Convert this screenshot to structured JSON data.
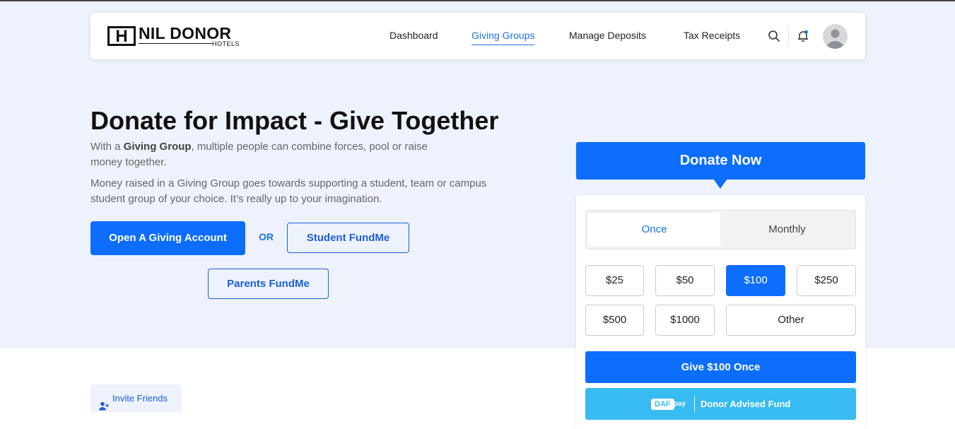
{
  "brand": {
    "logo_mark": "H",
    "name": "NIL DONOR",
    "sub": "HOTELS"
  },
  "nav": {
    "links": [
      {
        "label": "Dashboard",
        "active": false
      },
      {
        "label": "Giving Groups",
        "active": true
      },
      {
        "label": "Manage Deposits",
        "active": false
      },
      {
        "label": "Tax Receipts",
        "active": false
      }
    ],
    "icons": [
      "search-icon",
      "bell-icon",
      "avatar"
    ],
    "notification_dot_color": "#1a73e8"
  },
  "hero": {
    "title": "Donate for Impact - Give Together",
    "p1_prefix": "With a ",
    "p1_bold": "Giving Group",
    "p1_suffix_line1": ", multiple people can combine forces, pool or raise",
    "p1_line2": "money together.",
    "p2_line1": "Money raised in a Giving Group goes towards supporting a student, team or campus",
    "p2_line2": "student group of your choice. It’s really up to your imagination.",
    "open_account_label": "Open A Giving Account",
    "or_label": "OR",
    "student_fundme_label": "Student FundMe",
    "parents_fundme_label": "Parents FundMe"
  },
  "donate": {
    "header": "Donate Now",
    "frequency": {
      "options": [
        "Once",
        "Monthly"
      ],
      "selected": "Once"
    },
    "amounts": [
      "$25",
      "$50",
      "$100",
      "$250",
      "$500",
      "$1000",
      "Other"
    ],
    "selected_amount": "$100",
    "give_label": "Give $100 Once",
    "daf_badge": "DAF",
    "daf_pay": "pay",
    "daf_label": "Donor Advised Fund"
  },
  "invite": {
    "label": "Invite Friends",
    "icon": "user-plus-icon"
  },
  "colors": {
    "primary": "#0d6efd",
    "link": "#1a73e8",
    "hero_bg": "#edf2fc",
    "daf": "#37bbf0"
  }
}
